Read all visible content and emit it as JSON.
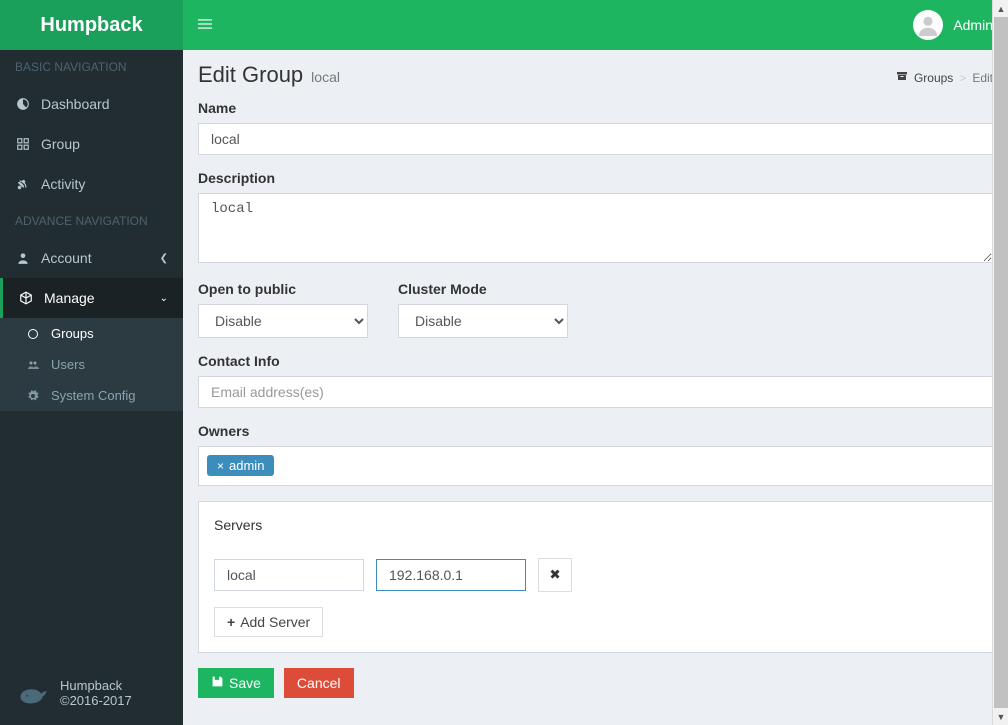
{
  "brand": "Humpback",
  "topbar": {
    "user": "Admin"
  },
  "sidebar": {
    "sections": {
      "basic": "BASIC NAVIGATION",
      "advance": "ADVANCE NAVIGATION"
    },
    "items": {
      "dashboard": "Dashboard",
      "group": "Group",
      "activity": "Activity",
      "account": "Account",
      "manage": "Manage"
    },
    "sub": {
      "groups": "Groups",
      "users": "Users",
      "system_config": "System Config"
    }
  },
  "footer": {
    "name": "Humpback",
    "copy": "©2016-2017"
  },
  "page": {
    "title": "Edit Group",
    "subtitle": "local",
    "breadcrumb": {
      "groups": "Groups",
      "edit": "Edit"
    }
  },
  "form": {
    "name_label": "Name",
    "name_value": "local",
    "desc_label": "Description",
    "desc_value": "local",
    "open_label": "Open to public",
    "open_value": "Disable",
    "cluster_label": "Cluster Mode",
    "cluster_value": "Disable",
    "contact_label": "Contact Info",
    "contact_placeholder": "Email address(es)",
    "owners_label": "Owners",
    "owners": [
      {
        "name": "admin"
      }
    ],
    "servers_label": "Servers",
    "servers": [
      {
        "name": "local",
        "ip": "192.168.0.1"
      }
    ],
    "add_server": "Add Server",
    "save": "Save",
    "cancel": "Cancel"
  }
}
